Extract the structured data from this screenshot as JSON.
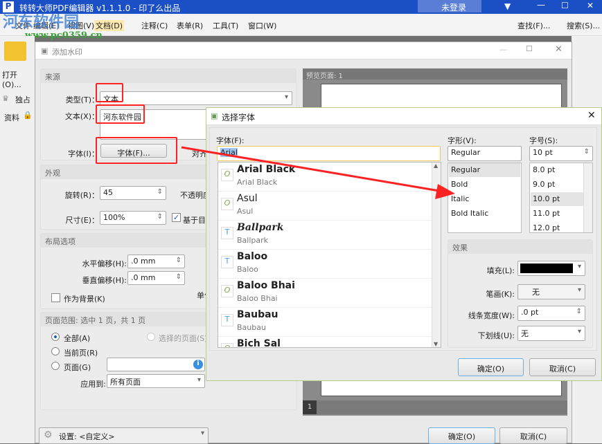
{
  "app": {
    "title": "转转大师PDF编辑器 v1.1.1.0 - 印了么出品",
    "login": "未登录",
    "watermark_logo": "河东软件园",
    "watermark_url": "www.pc0359.cn"
  },
  "menu": [
    "文件",
    "编辑(E)",
    "视图(V)",
    "文档(D)",
    "注释(C)",
    "表单(R)",
    "工具(T)",
    "窗口(W)"
  ],
  "menu_right": {
    "find": "查找(F)...",
    "search": "搜索(S)..."
  },
  "left_toolbar": {
    "open": "打开(O)...",
    "exclusive": "独占",
    "docs": "资料"
  },
  "watermark_dialog": {
    "title": "添加水印",
    "source": {
      "heading": "来源",
      "type_label": "类型(T)：",
      "type_value": "文本",
      "text_label": "文本(X)：",
      "text_value": "河东软件园",
      "font_label": "字体(I)：",
      "font_button": "字体(F)...",
      "align_label": "对齐"
    },
    "appearance": {
      "heading": "外观",
      "rotate_label": "旋转(R)：",
      "rotate_value": "45",
      "opacity_label": "不透明度",
      "size_label": "尺寸(E)：",
      "size_value": "100%",
      "relative_label": "基于目标",
      "relative_checked": true
    },
    "layout": {
      "heading": "布局选项",
      "h_offset_label": "水平偏移(H):",
      "h_offset_value": ".0 mm",
      "v_offset_label": "垂直偏移(H):",
      "v_offset_value": ".0 mm",
      "background_label": "作为背景(K)",
      "unit_label": "单位"
    },
    "range": {
      "heading": "页面范围: 选中 1 页，共 1 页",
      "all": "全部(A)",
      "selected": "选择的页面(S)",
      "current": "当前页(R)",
      "pages": "页面(G)",
      "apply_label": "应用到:",
      "apply_value": "所有页面"
    },
    "preview": {
      "heading": "预览页面: 1",
      "page_num": "1"
    },
    "settings_label": "设置: <自定义>",
    "ok": "确定(O)",
    "cancel": "取消(C)"
  },
  "font_dialog": {
    "title": "选择字体",
    "font_label": "字体(F):",
    "font_value": "Arial",
    "fonts": [
      {
        "name": "Arial Black",
        "icon": "O"
      },
      {
        "name": "Asul",
        "icon": "O"
      },
      {
        "name": "Ballpark",
        "icon": "TT"
      },
      {
        "name": "Baloo",
        "icon": "TT"
      },
      {
        "name": "Baloo Bhai",
        "icon": "O"
      },
      {
        "name": "Baubau",
        "icon": "TT"
      },
      {
        "name": "Bich Sal",
        "icon": "O"
      }
    ],
    "style_label": "字形(V):",
    "style_value": "Regular",
    "styles": [
      "Regular",
      "Bold",
      "Italic",
      "Bold Italic"
    ],
    "size_label": "字号(S):",
    "size_value": "10 pt",
    "sizes": [
      "8.0 pt",
      "9.0 pt",
      "10.0 pt",
      "11.0 pt",
      "12.0 pt"
    ],
    "effects": {
      "heading": "效果",
      "fill_label": "填充(L):",
      "fill_color": "#000000",
      "stroke_label": "笔画(K):",
      "stroke_value": "无",
      "width_label": "线条宽度(W):",
      "width_value": ".0 pt",
      "underline_label": "下划线(U):",
      "underline_value": "无"
    },
    "ok": "确定(O)",
    "cancel": "取消(C)"
  },
  "colors": {
    "titlebar": "#1b4fc6",
    "annotation": "#ff2222"
  }
}
